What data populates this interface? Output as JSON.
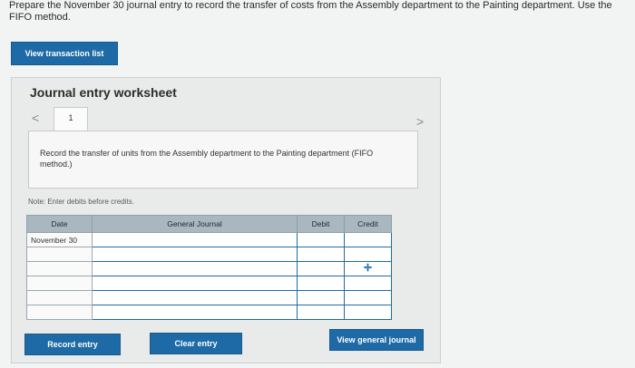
{
  "instructions": "Prepare the November 30 journal entry to record the transfer of costs from the Assembly department to the Painting department. Use the FIFO method.",
  "buttons": {
    "view_transaction_list": "View transaction list",
    "record_entry": "Record entry",
    "clear_entry": "Clear entry",
    "view_general_journal": "View general journal"
  },
  "worksheet": {
    "title": "Journal entry worksheet",
    "current_tab": "1",
    "description": "Record the transfer of units from the Assembly department to the Painting department (FIFO method.)",
    "note": "Note: Enter debits before credits."
  },
  "table": {
    "columns": [
      "Date",
      "General Journal",
      "Debit",
      "Credit"
    ],
    "rows": [
      {
        "date": "November 30",
        "account": "",
        "debit": "",
        "credit": ""
      },
      {
        "date": "",
        "account": "",
        "debit": "",
        "credit": ""
      },
      {
        "date": "",
        "account": "",
        "debit": "",
        "credit": ""
      },
      {
        "date": "",
        "account": "",
        "debit": "",
        "credit": ""
      },
      {
        "date": "",
        "account": "",
        "debit": "",
        "credit": ""
      },
      {
        "date": "",
        "account": "",
        "debit": "",
        "credit": ""
      }
    ]
  },
  "icons": {
    "prev": "chevron-left-icon",
    "next": "chevron-right-icon",
    "cursor": "cursor-plus-icon"
  },
  "colors": {
    "accent": "#1d6aa6",
    "header": "#a9b7bf"
  }
}
